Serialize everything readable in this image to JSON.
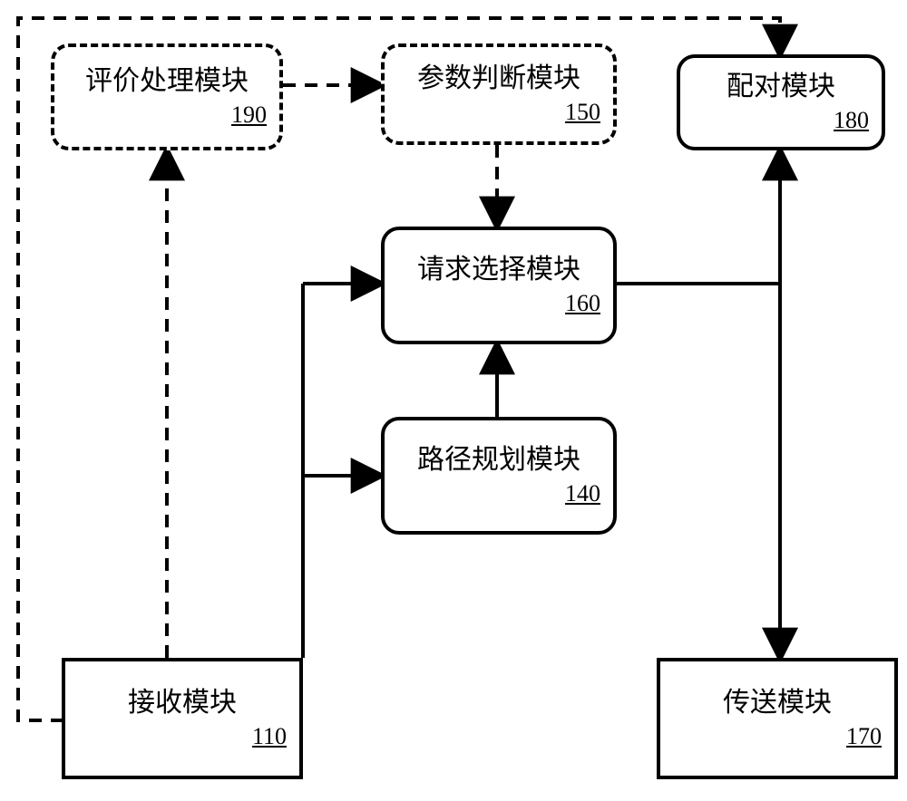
{
  "modules": {
    "eval": {
      "label": "评价处理模块",
      "num": "190"
    },
    "param": {
      "label": "参数判断模块",
      "num": "150"
    },
    "pair": {
      "label": "配对模块",
      "num": "180"
    },
    "reqsel": {
      "label": "请求选择模块",
      "num": "160"
    },
    "route": {
      "label": "路径规划模块",
      "num": "140"
    },
    "recv": {
      "label": "接收模块",
      "num": "110"
    },
    "send": {
      "label": "传送模块",
      "num": "170"
    }
  }
}
